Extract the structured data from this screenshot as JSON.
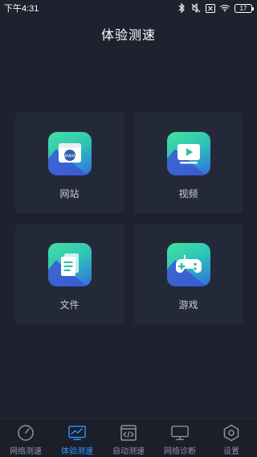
{
  "status_bar": {
    "time": "下午4:31",
    "battery": "17"
  },
  "header": {
    "title": "体验测速"
  },
  "tiles": [
    {
      "label": "网站",
      "icon": "www-icon"
    },
    {
      "label": "视频",
      "icon": "video-play-icon"
    },
    {
      "label": "文件",
      "icon": "document-icon"
    },
    {
      "label": "游戏",
      "icon": "gamepad-icon"
    }
  ],
  "bottom_nav": {
    "active": "体验测速",
    "items": [
      {
        "label": "网络测速",
        "icon": "speedometer-icon"
      },
      {
        "label": "体验测速",
        "icon": "monitor-chart-icon"
      },
      {
        "label": "自动测速",
        "icon": "code-window-icon"
      },
      {
        "label": "网络诊断",
        "icon": "monitor-icon"
      },
      {
        "label": "设置",
        "icon": "hexagon-settings-icon"
      }
    ]
  },
  "colors": {
    "background": "#1d222e",
    "tile": "#232938",
    "active": "#2f9bff",
    "inactive": "#8d93a0"
  },
  "icon_www_text": "WWW"
}
